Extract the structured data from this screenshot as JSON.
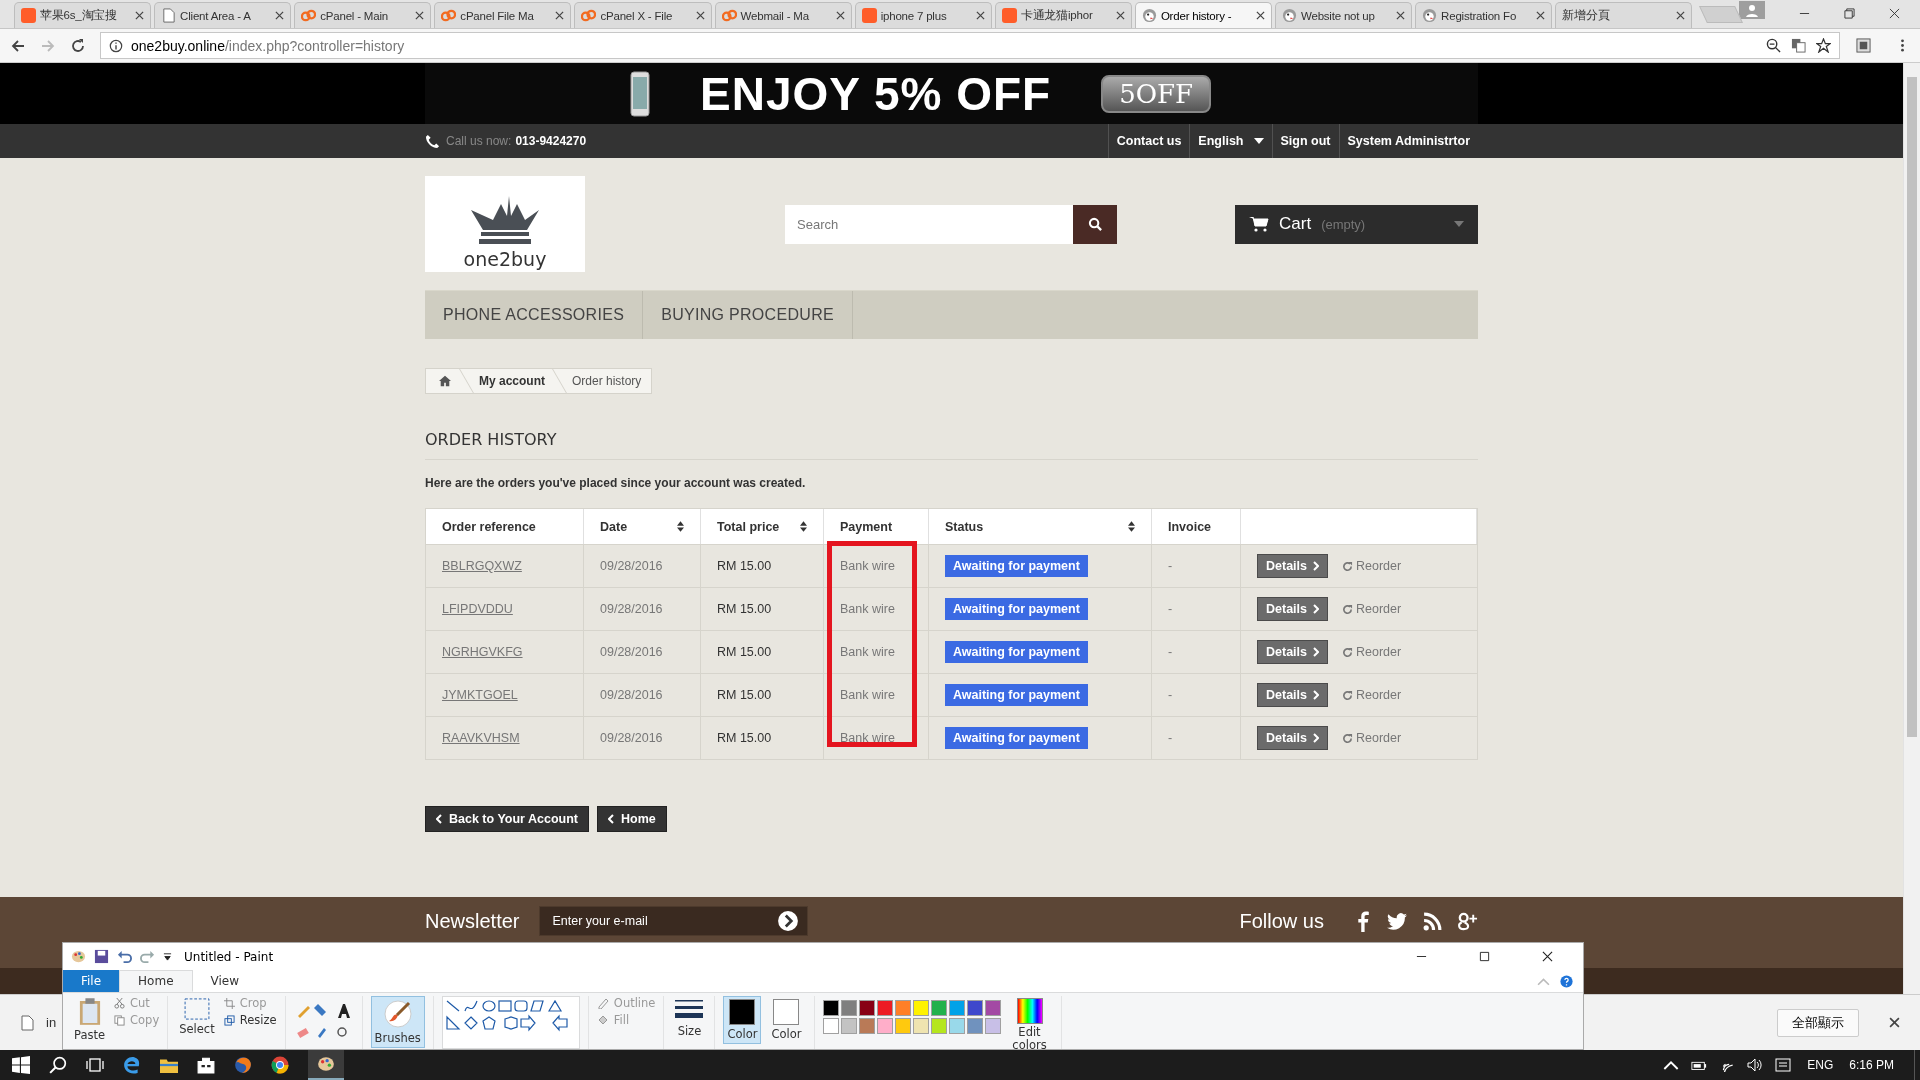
{
  "browser": {
    "tabs": [
      {
        "title": "苹果6s_淘宝搜",
        "kind": "taobao",
        "selected": false
      },
      {
        "title": "Client Area - A",
        "kind": "page",
        "selected": false
      },
      {
        "title": "cPanel - Main",
        "kind": "cpanel",
        "selected": false
      },
      {
        "title": "cPanel File Ma",
        "kind": "cpanel",
        "selected": false
      },
      {
        "title": "cPanel X - File",
        "kind": "cpanel",
        "selected": false
      },
      {
        "title": "Webmail - Ma",
        "kind": "cpanel",
        "selected": false
      },
      {
        "title": "iphone 7 plus",
        "kind": "taobao",
        "selected": false
      },
      {
        "title": "卡通龙猫iphor",
        "kind": "taobao",
        "selected": false
      },
      {
        "title": "Order history -",
        "kind": "shop",
        "selected": true
      },
      {
        "title": "Website not up",
        "kind": "shop",
        "selected": false
      },
      {
        "title": "Registration Fo",
        "kind": "shop",
        "selected": false
      },
      {
        "title": "新增分頁",
        "kind": "blank",
        "selected": false
      }
    ],
    "address": {
      "host": "one2buy.online",
      "path": "/index.php?controller=history"
    }
  },
  "page": {
    "banner": {
      "headline": "ENJOY 5% OFF",
      "code": "5OFF"
    },
    "topbar": {
      "call_label": "Call us now:",
      "phone": "013-9424270",
      "links": [
        "Contact us",
        "English",
        "Sign out",
        "System Administrtor"
      ]
    },
    "logo": {
      "name": "one2buy"
    },
    "search": {
      "placeholder": "Search"
    },
    "cart": {
      "label": "Cart",
      "state": "(empty)"
    },
    "menu": [
      "PHONE ACCESSORIES",
      "BUYING PROCEDURE"
    ],
    "breadcrumb": [
      "My account",
      "Order history"
    ],
    "heading": "ORDER HISTORY",
    "intro": "Here are the orders you've placed since your account was created.",
    "table": {
      "columns": [
        {
          "label": "Order reference",
          "sortable": false
        },
        {
          "label": "Date",
          "sortable": true
        },
        {
          "label": "Total price",
          "sortable": true
        },
        {
          "label": "Payment",
          "sortable": false
        },
        {
          "label": "Status",
          "sortable": true
        },
        {
          "label": "Invoice",
          "sortable": false
        }
      ],
      "rows": [
        {
          "reference": "BBLRGQXWZ",
          "date": "09/28/2016",
          "total": "RM 15.00",
          "payment": "Bank wire",
          "status": "Awaiting for payment",
          "invoice": "-",
          "details": "Details",
          "reorder": "Reorder"
        },
        {
          "reference": "LFIPDVDDU",
          "date": "09/28/2016",
          "total": "RM 15.00",
          "payment": "Bank wire",
          "status": "Awaiting for payment",
          "invoice": "-",
          "details": "Details",
          "reorder": "Reorder"
        },
        {
          "reference": "NGRHGVKFG",
          "date": "09/28/2016",
          "total": "RM 15.00",
          "payment": "Bank wire",
          "status": "Awaiting for payment",
          "invoice": "-",
          "details": "Details",
          "reorder": "Reorder"
        },
        {
          "reference": "JYMKTGOEL",
          "date": "09/28/2016",
          "total": "RM 15.00",
          "payment": "Bank wire",
          "status": "Awaiting for payment",
          "invoice": "-",
          "details": "Details",
          "reorder": "Reorder"
        },
        {
          "reference": "RAAVKVHSM",
          "date": "09/28/2016",
          "total": "RM 15.00",
          "payment": "Bank wire",
          "status": "Awaiting for payment",
          "invoice": "-",
          "details": "Details",
          "reorder": "Reorder"
        }
      ]
    },
    "buttons": [
      "Back to Your Account",
      "Home"
    ],
    "newsletter": {
      "title": "Newsletter",
      "placeholder": "Enter your e-mail"
    },
    "follow_us": "Follow us"
  },
  "downloads_bar": {
    "file": "in",
    "show_all": "全部顯示"
  },
  "paint": {
    "title": "Untitled - Paint",
    "tabs": [
      {
        "label": "File",
        "selected": false
      },
      {
        "label": "Home",
        "selected": true
      },
      {
        "label": "View",
        "selected": false
      }
    ],
    "tools": {
      "paste": "Paste",
      "cut": "Cut",
      "copy": "Copy",
      "select": "Select",
      "crop": "Crop",
      "resize": "Resize",
      "brushes": "Brushes",
      "outline": "Outline",
      "fill": "Fill",
      "size": "Size",
      "edit_colors": "Edit colors"
    },
    "colors": [
      {
        "label": "Color",
        "color": "#000000",
        "selected": true
      },
      {
        "label": "Color",
        "color": "#ffffff",
        "selected": false
      }
    ],
    "palette": [
      {
        "color": "#000000"
      },
      {
        "color": "#7f7f7f"
      },
      {
        "color": "#880015"
      },
      {
        "color": "#ed1c24"
      },
      {
        "color": "#ff7f27"
      },
      {
        "color": "#fff200"
      },
      {
        "color": "#22b14c"
      },
      {
        "color": "#00a2e8"
      },
      {
        "color": "#3f48cc"
      },
      {
        "color": "#a349a4"
      },
      {
        "color": "#ffffff"
      },
      {
        "color": "#c3c3c3"
      },
      {
        "color": "#b97a57"
      },
      {
        "color": "#ffaec9"
      },
      {
        "color": "#ffc90e"
      },
      {
        "color": "#efe4b0"
      },
      {
        "color": "#b5e61d"
      },
      {
        "color": "#99d9ea"
      },
      {
        "color": "#7092be"
      },
      {
        "color": "#c8bfe7"
      }
    ]
  },
  "taskbar": {
    "language": "ENG",
    "time": "6:16 PM"
  }
}
